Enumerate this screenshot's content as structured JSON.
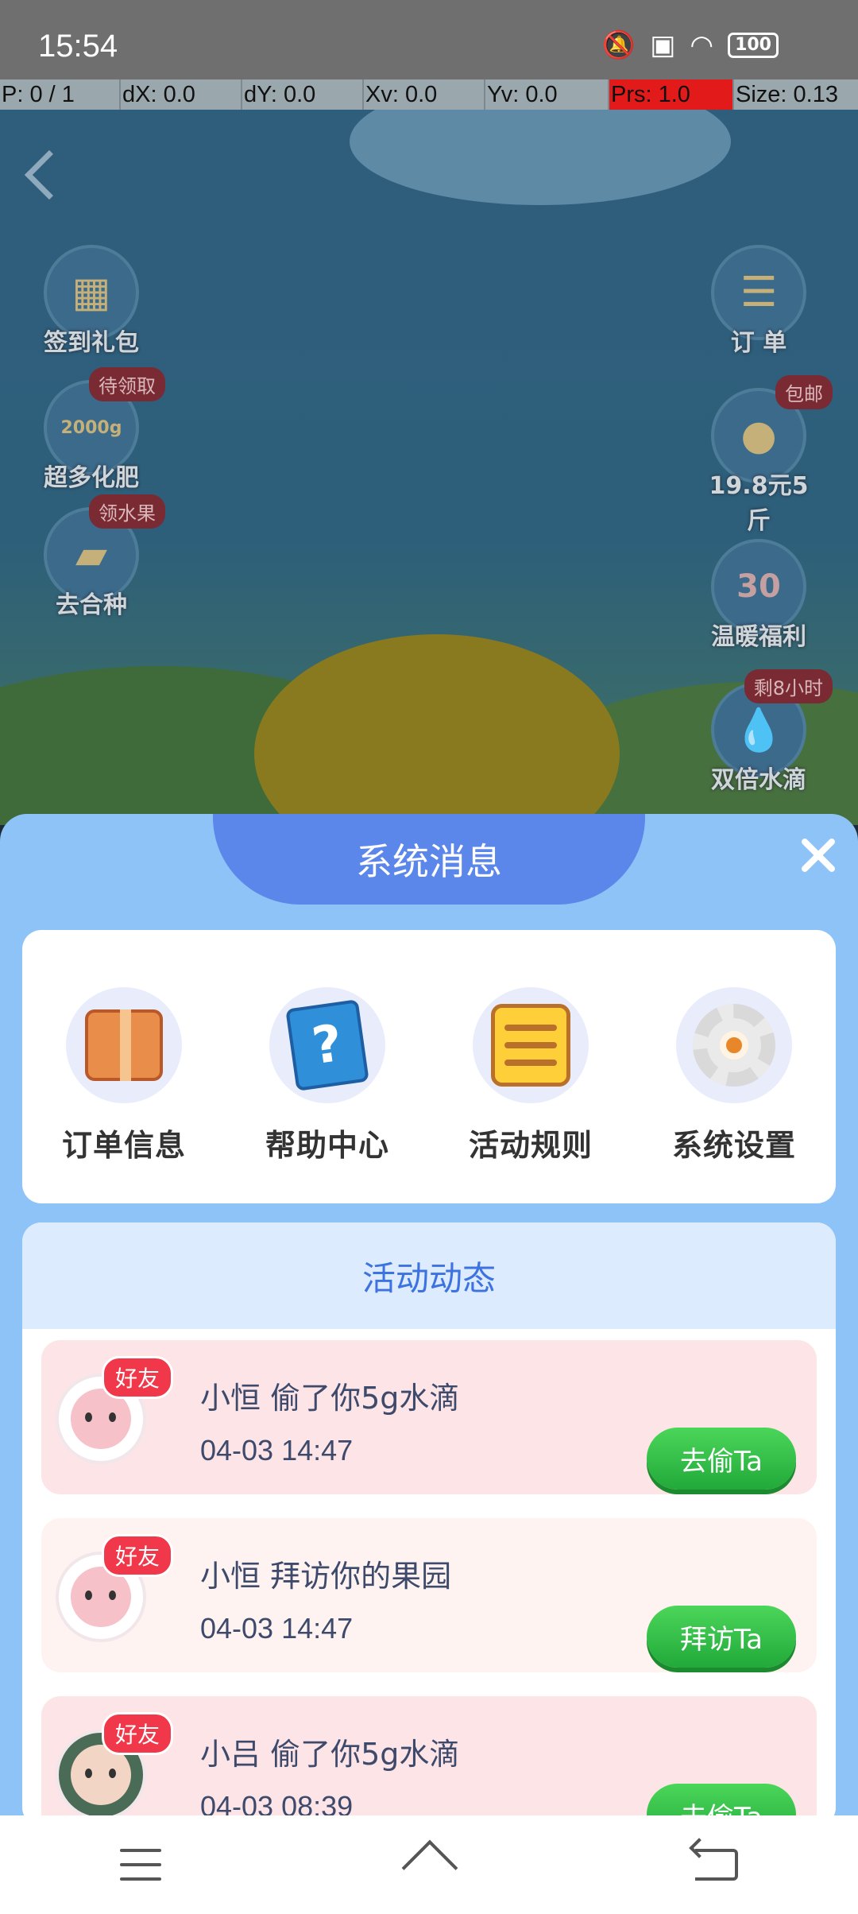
{
  "status_bar": {
    "time": "15:54",
    "battery": "100"
  },
  "debug": {
    "p": "P: 0 / 1",
    "dx": "dX: 0.0",
    "dy": "dY: 0.0",
    "xv": "Xv: 0.0",
    "yv": "Yv: 0.0",
    "prs": "Prs: 1.0",
    "size": "Size: 0.13"
  },
  "game": {
    "left_items": [
      {
        "label": "签到礼包",
        "icon": "calendar-icon",
        "badge": ""
      },
      {
        "label": "超多化肥",
        "icon": "fertilizer-icon",
        "badge": "待领取",
        "sub": "2000g"
      },
      {
        "label": "去合种",
        "icon": "seed-bag-icon",
        "badge": "领水果"
      }
    ],
    "right_items": [
      {
        "label": "订 单",
        "icon": "order-icon",
        "badge": ""
      },
      {
        "label": "19.8元5斤",
        "icon": "mango-icon",
        "badge": "包邮"
      },
      {
        "label": "温暖福利",
        "icon": "gift-jar-icon",
        "badge": "",
        "sub": "30"
      },
      {
        "label": "双倍水滴",
        "icon": "water-drop-icon",
        "badge": "剩8小时"
      }
    ]
  },
  "sheet": {
    "title": "系统消息",
    "menu": [
      {
        "label": "订单信息",
        "icon": "package-box-icon"
      },
      {
        "label": "帮助中心",
        "icon": "help-book-icon"
      },
      {
        "label": "活动规则",
        "icon": "rules-list-icon"
      },
      {
        "label": "系统设置",
        "icon": "settings-gear-icon"
      }
    ],
    "activity_title": "活动动态",
    "activity": [
      {
        "badge": "好友",
        "text": "小恒 偷了你5g水滴",
        "time": "04-03 14:47",
        "button": "去偷Ta"
      },
      {
        "badge": "好友",
        "text": "小恒 拜访你的果园",
        "time": "04-03 14:47",
        "button": "拜访Ta"
      },
      {
        "badge": "好友",
        "text": "小吕 偷了你5g水滴",
        "time": "04-03 08:39",
        "button": "去偷Ta"
      }
    ]
  },
  "colors": {
    "sheet_bg": "#8ec3f7",
    "tab_bg": "#5b86ea",
    "accent_blue": "#3d72e0",
    "button_green": "#22a93a",
    "badge_red": "#f0384a"
  }
}
